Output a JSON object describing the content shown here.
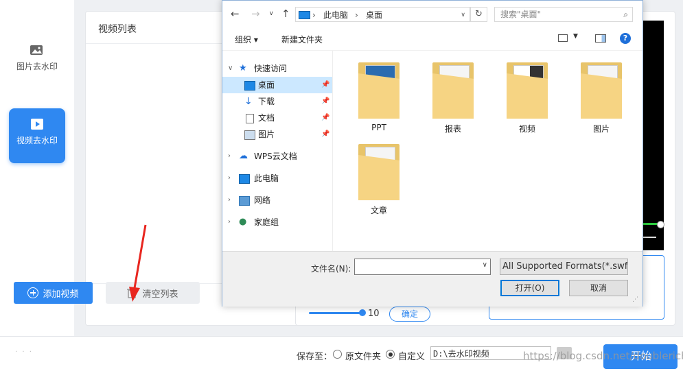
{
  "sidebar": {
    "items": [
      {
        "label": "图片去水印",
        "icon": "image-icon"
      },
      {
        "label": "视频去水印",
        "icon": "video-icon",
        "active": true
      }
    ]
  },
  "video_list": {
    "title": "视频列表",
    "add_label": "添加视频",
    "clear_label": "清空列表"
  },
  "preview": {
    "slider_value": "10",
    "confirm_label": "确定"
  },
  "bottom": {
    "save_to_label": "保存至：",
    "radio_original": "原文件夹",
    "radio_custom": "自定义",
    "path_value": "D:\\去水印视频",
    "start_label": "开始",
    "watermark": "https://blog.csdn.net/doublerich"
  },
  "dialog": {
    "address": {
      "root": "此电脑",
      "current": "桌面"
    },
    "search_placeholder": "搜索\"桌面\"",
    "toolbar": {
      "organize": "组织 ▾",
      "new_folder": "新建文件夹"
    },
    "nav": {
      "quick_access": "快速访问",
      "items": [
        {
          "label": "桌面",
          "selected": true
        },
        {
          "label": "下载"
        },
        {
          "label": "文档"
        },
        {
          "label": "图片"
        }
      ],
      "roots": [
        "WPS云文档",
        "此电脑",
        "网络",
        "家庭组"
      ]
    },
    "folders": [
      "PPT",
      "报表",
      "视频",
      "图片",
      "文章"
    ],
    "filename_label": "文件名(N):",
    "filename_value": "",
    "filter_value": "All Supported Formats(*.swf;",
    "open_label": "打开(O)",
    "cancel_label": "取消"
  },
  "colors": {
    "accent": "#2f88f1",
    "arrow": "#e8261f",
    "folder": "#f6d483"
  }
}
